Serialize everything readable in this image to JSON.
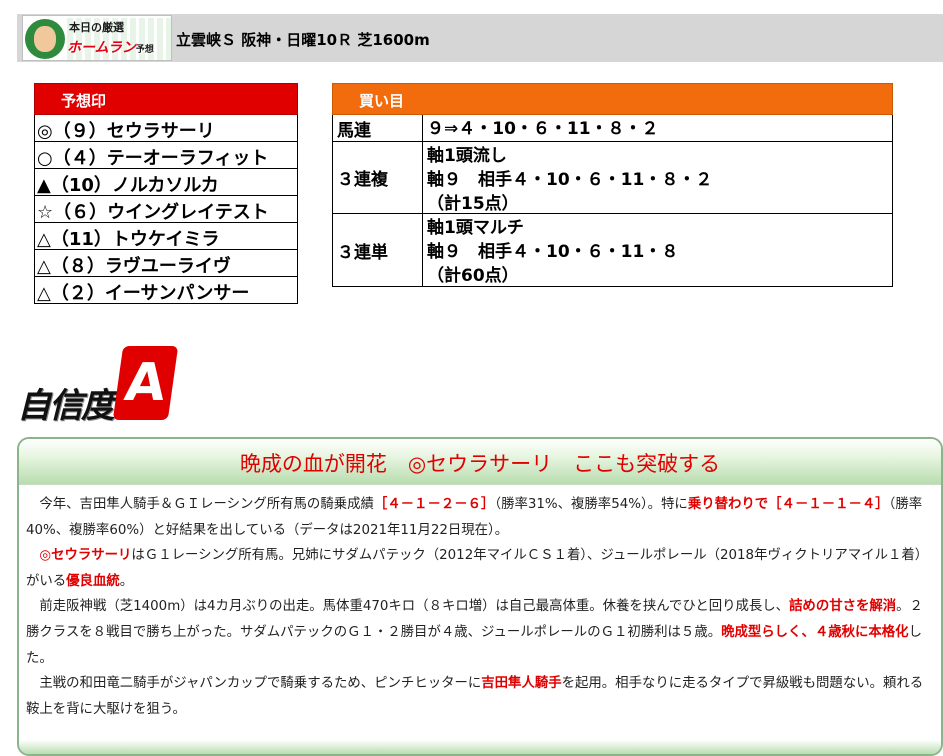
{
  "header": {
    "logo_line1": "本日の厳選",
    "logo_line2": "ホームラン",
    "logo_line2_suffix": "予想",
    "race_title": "立雲峡Ｓ 阪神・日曜10Ｒ 芝1600m"
  },
  "marks": {
    "heading": "予想印",
    "rows": [
      "◎（９）セウラサーリ",
      "○（４）テーオーラフィット",
      "▲（10）ノルカソルカ",
      "☆（６）ウイングレイテスト",
      "△（11）トウケイミラ",
      "△（８）ラヴユーライヴ",
      "△（２）イーサンパンサー"
    ]
  },
  "bets": {
    "heading": "買い目",
    "rows": [
      {
        "type": "馬連",
        "lines": [
          "９⇒４・10・６・11・８・２"
        ]
      },
      {
        "type": "３連複",
        "lines": [
          "軸1頭流し",
          "軸９　相手４・10・６・11・８・２",
          "（計15点）"
        ]
      },
      {
        "type": "３連単",
        "lines": [
          "軸1頭マルチ",
          "軸９　相手４・10・６・11・８",
          "（計60点）"
        ]
      }
    ]
  },
  "confidence": {
    "label": "自信度",
    "grade": "A"
  },
  "commentary": {
    "headline": "晩成の血が開花　◎セウラサーリ　ここも突破する",
    "p1": {
      "t1": "今年、吉田隼人騎手＆ＧＩレーシング所有馬の騎乗成績",
      "h1": "［４－１－２－６］",
      "t2": "（勝率31%、複勝率54%）。特に",
      "h2": "乗り替わりで［４－１－１－４］",
      "t3": "（勝率40%、複勝率60%）と好結果を出している（データは2021年11月22日現在）。"
    },
    "p2": {
      "h1": "◎セウラサーリ",
      "t1": "はＧ１レーシング所有馬。兄姉にサダムパテック（2012年マイルＣＳ１着）、ジュールポレール（2018年ヴィクトリアマイル１着）がいる",
      "h2": "優良血統",
      "t2": "。"
    },
    "p3": {
      "t1": "前走阪神戦（芝1400m）は4カ月ぶりの出走。馬体重470キロ（８キロ増）は自己最高体重。休養を挟んでひと回り成長し、",
      "h1": "詰めの甘さを解消",
      "t2": "。２勝クラスを８戦目で勝ち上がった。サダムパテックのＧ１・２勝目が４歳、ジュールポレールのＧ１初勝利は５歳。",
      "h2": "晩成型らしく、４歳秋に本格化",
      "t3": "した。"
    },
    "p4": {
      "t1": "主戦の和田竜二騎手がジャパンカップで騎乗するため、ピンチヒッターに",
      "h1": "吉田隼人騎手",
      "t2": "を起用。相手なりに走るタイプで昇級戦も問題ない。頼れる鞍上を背に大駆けを狙う。"
    }
  },
  "colors": {
    "marks_header": "#e00000",
    "bets_header": "#f26c0d",
    "highlight": "#e00000",
    "comment_border": "#8ab48a"
  }
}
